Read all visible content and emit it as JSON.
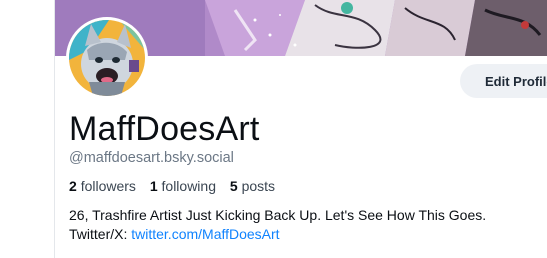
{
  "profile": {
    "display_name": "MaffDoesArt",
    "handle": "@maffdoesart.bsky.social",
    "edit_button_label": "Edit Profile",
    "stats": {
      "followers_count": "2",
      "followers_label": "followers",
      "following_count": "1",
      "following_label": "following",
      "posts_count": "5",
      "posts_label": "posts"
    },
    "bio": {
      "line1": "26, Trashfire Artist Just Kicking Back Up.  Let's See How This Goes.",
      "line2_prefix": "Twitter/X: ",
      "line2_link": "twitter.com/MaffDoesArt"
    }
  },
  "colors": {
    "link": "#1083fe",
    "handle": "#6b7785",
    "button_bg": "#eef1f5",
    "banner_purple": "#b08ac9"
  },
  "icons": {
    "avatar": "wolf-character-avatar",
    "banner": "artwork-banner"
  }
}
